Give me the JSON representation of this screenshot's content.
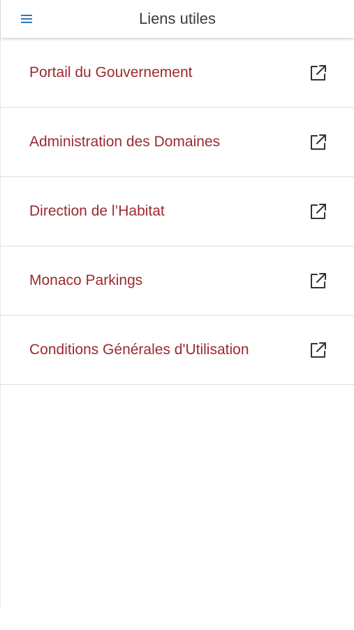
{
  "header": {
    "title": "Liens utiles",
    "menu_icon": "hamburger-menu-icon"
  },
  "colors": {
    "link_text": "#9b2a2f",
    "menu_icon": "#2f78b7",
    "title_text": "#3c3c3c",
    "divider": "#dcdcdc"
  },
  "links": [
    {
      "label": "Portail du Gouvernement",
      "icon": "external-link-icon"
    },
    {
      "label": "Administration des Domaines",
      "icon": "external-link-icon"
    },
    {
      "label": "Direction de l’Habitat",
      "icon": "external-link-icon"
    },
    {
      "label": "Monaco Parkings",
      "icon": "external-link-icon"
    },
    {
      "label": "Conditions Générales d'Utilisation",
      "icon": "external-link-icon"
    }
  ]
}
